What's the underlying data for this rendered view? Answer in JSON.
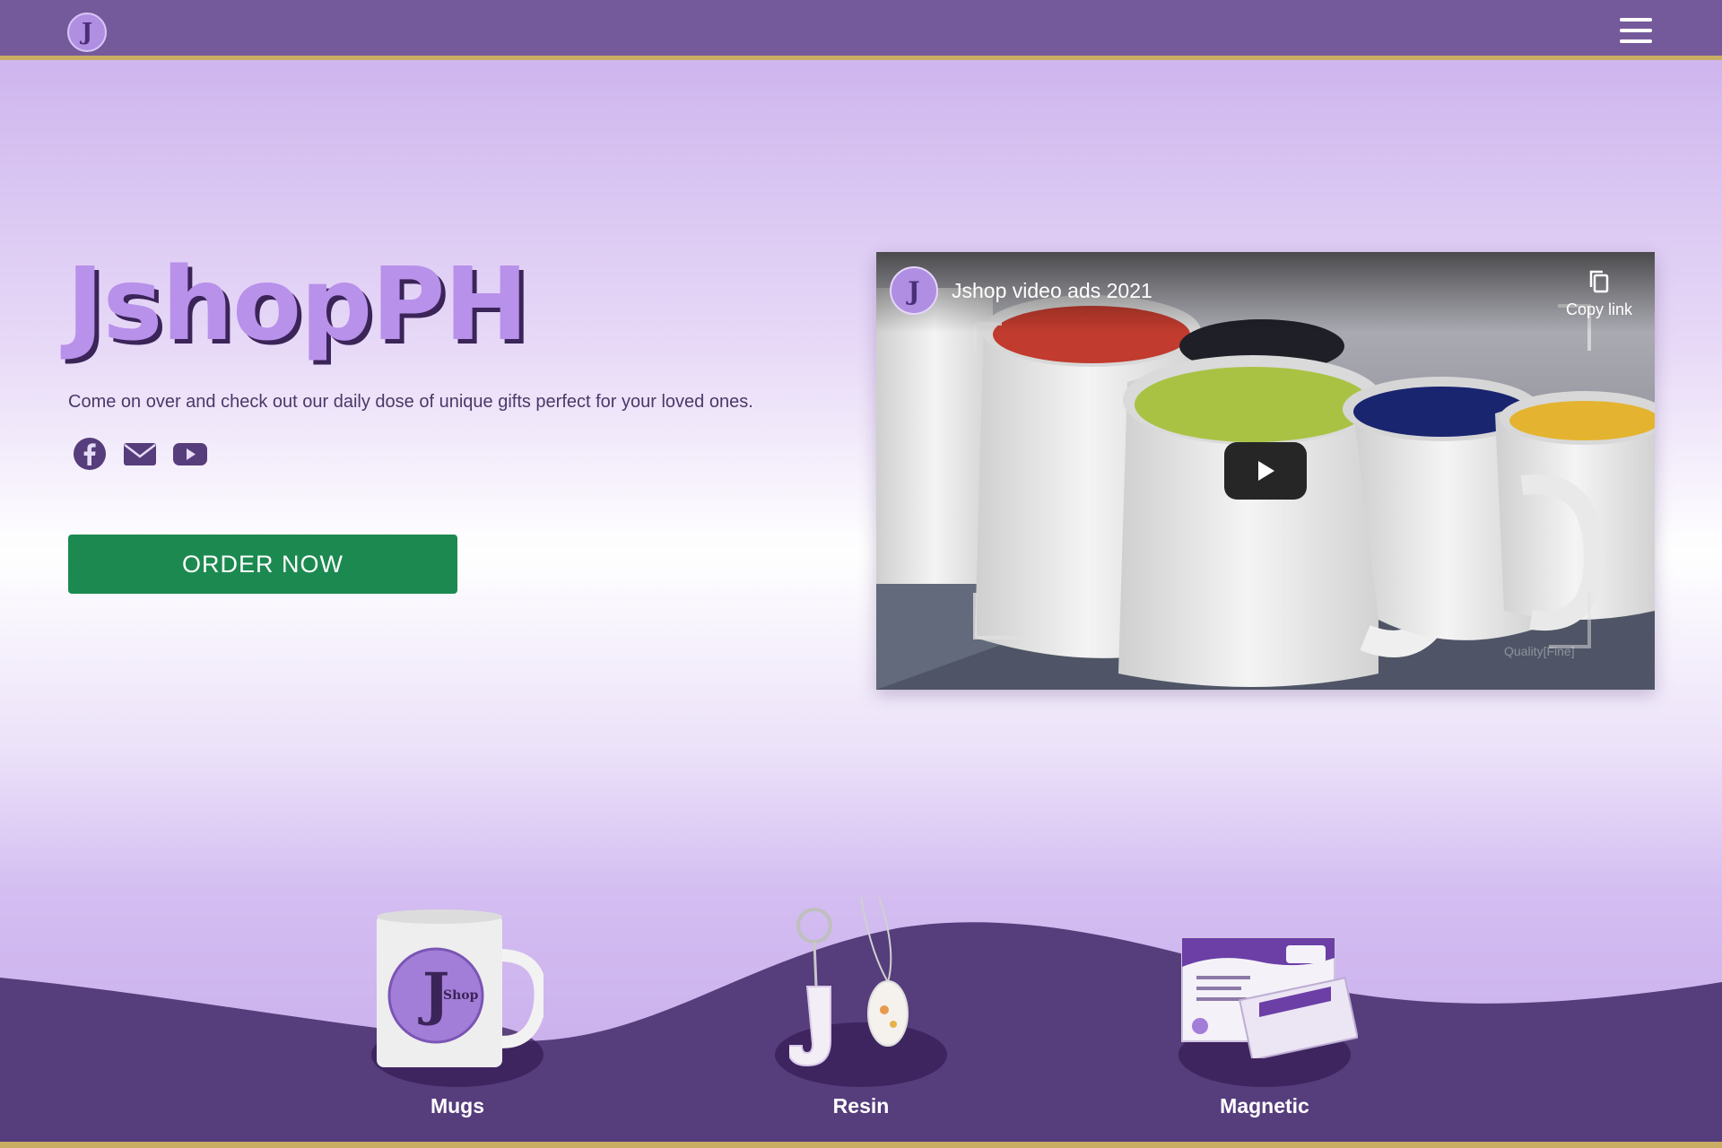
{
  "nav": {
    "logo_text": "J",
    "menu_icon": "hamburger-icon"
  },
  "hero": {
    "title": "JshopPH",
    "subtitle": "Come on over and check out our daily dose of unique gifts perfect for your loved ones.",
    "social": [
      "facebook-icon",
      "envelope-icon",
      "youtube-icon"
    ],
    "cta_label": "ORDER NOW"
  },
  "video": {
    "title": "Jshop video ads 2021",
    "copy_link_label": "Copy link",
    "channel_avatar_text": "J",
    "watermark": "Quality[Fine]"
  },
  "products": [
    {
      "label": "Mugs"
    },
    {
      "label": "Resin"
    },
    {
      "label": "Magnetic"
    }
  ],
  "colors": {
    "navbar": "#755a9b",
    "accent_gold": "#c9ad63",
    "cta_green": "#1c8a50",
    "wave_purple": "#563d7c",
    "title_lilac": "#b891ea"
  }
}
